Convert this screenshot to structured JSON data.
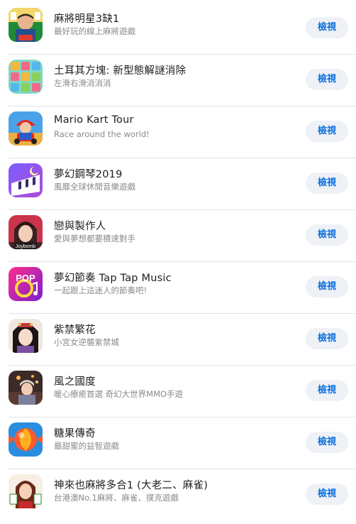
{
  "apps": [
    {
      "title": "麻將明星3缺1",
      "subtitle": "最好玩的線上麻將遊戲",
      "button": "檢視",
      "icon": "mahjong-star-app-icon"
    },
    {
      "title": "土耳其方塊: 新型態解謎消除",
      "subtitle": "左滑右滑消消消",
      "button": "檢視",
      "icon": "turkish-blocks-app-icon"
    },
    {
      "title": "Mario Kart Tour",
      "subtitle": "Race around the world!",
      "button": "檢視",
      "icon": "mario-kart-app-icon"
    },
    {
      "title": "夢幻鋼琴2019",
      "subtitle": "風靡全球休閒音樂遊戲",
      "button": "檢視",
      "icon": "dream-piano-app-icon"
    },
    {
      "title": "戀與製作人",
      "subtitle": "愛與夢想都要積速對手",
      "button": "檢視",
      "icon": "love-producer-app-icon",
      "icon_text": "Joybomb"
    },
    {
      "title": "夢幻節奏 Tap Tap Music",
      "subtitle": "一起跟上這迷人的節奏吧!",
      "button": "檢視",
      "icon": "tap-tap-music-app-icon",
      "icon_text": "POP"
    },
    {
      "title": "紫禁繁花",
      "subtitle": "小宮女逆襲紫禁城",
      "button": "檢視",
      "icon": "forbidden-city-app-icon"
    },
    {
      "title": "風之國度",
      "subtitle": "暖心療癒首選 奇幻大世界MMO手遊",
      "button": "檢視",
      "icon": "wind-kingdom-app-icon"
    },
    {
      "title": "糖果傳奇",
      "subtitle": "最甜蜜的益智遊戲",
      "button": "檢視",
      "icon": "candy-crush-app-icon"
    },
    {
      "title": "神來也麻將多合1 (大老二、麻雀)",
      "subtitle": "台港澳No.1麻將、麻雀、撲克遊戲",
      "button": "檢視",
      "icon": "godlike-mahjong-app-icon"
    }
  ],
  "colors": {
    "button_bg": "#eef1f6",
    "button_text": "#0a6fe0",
    "title_text": "#1d1d1f",
    "subtitle_text": "#8a8a8e",
    "divider": "#e3e3e6"
  }
}
